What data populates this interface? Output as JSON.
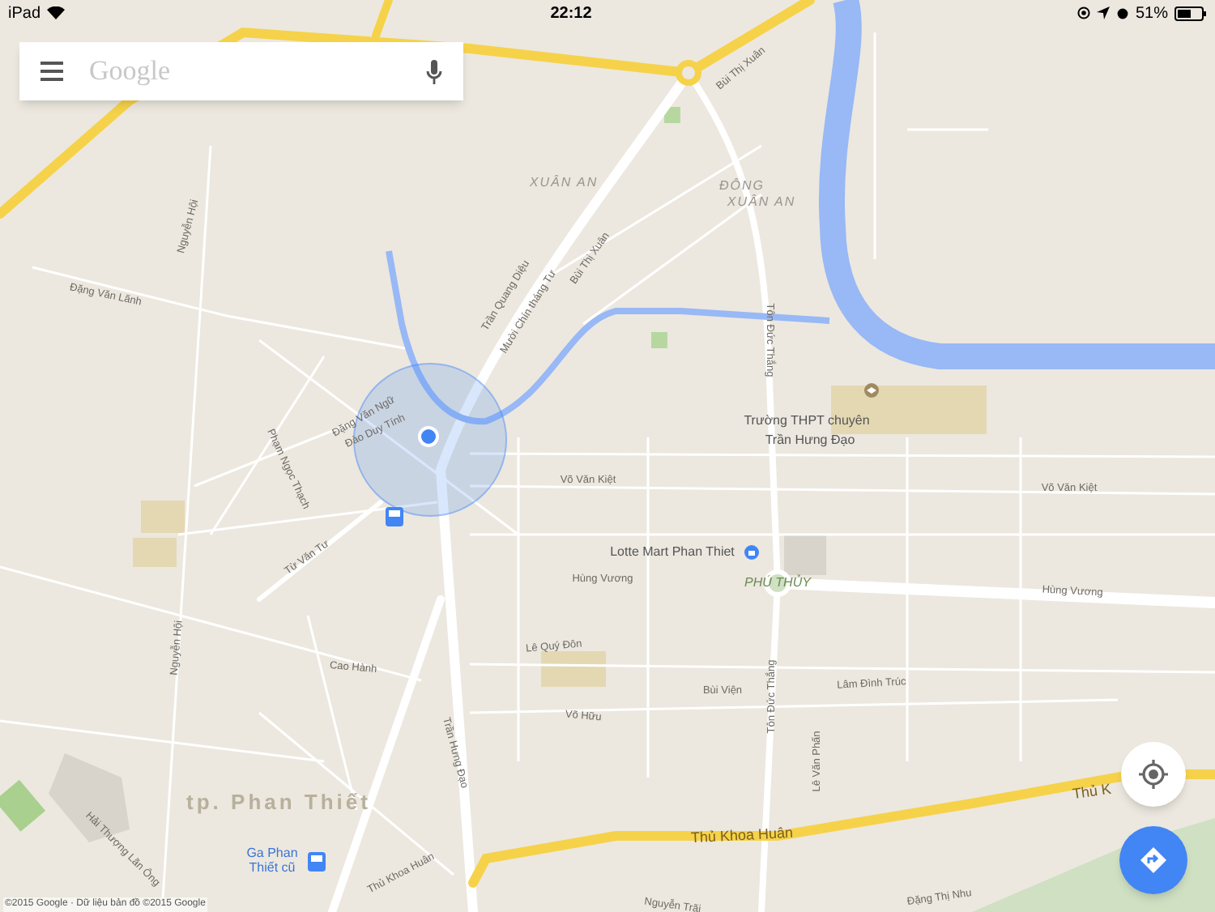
{
  "status_bar": {
    "device": "iPad",
    "time": "22:12",
    "battery": "51%"
  },
  "search": {
    "placeholder": "Google"
  },
  "map": {
    "labels": [
      {
        "text": "XUÂN AN",
        "kind": "area"
      },
      {
        "text": "ĐÔNG",
        "kind": "area"
      },
      {
        "text": "XUÂN AN",
        "kind": "area"
      },
      {
        "text": "Mười Chín tháng Tư",
        "kind": "street"
      },
      {
        "text": "Trần Quang Diệu",
        "kind": "street"
      },
      {
        "text": "Bùi Thị Xuân",
        "kind": "street"
      },
      {
        "text": "Bùi Thị Xuân",
        "kind": "street"
      },
      {
        "text": "Tôn Đức Thắng",
        "kind": "street"
      },
      {
        "text": "Tôn Đức Thắng",
        "kind": "street"
      },
      {
        "text": "Trường THPT chuyên",
        "kind": "poi"
      },
      {
        "text": "Trần Hưng Đạo",
        "kind": "poi"
      },
      {
        "text": "Võ Văn Kiệt",
        "kind": "street"
      },
      {
        "text": "Võ Văn Kiệt",
        "kind": "street"
      },
      {
        "text": "Lotte Mart Phan Thiet",
        "kind": "poi"
      },
      {
        "text": "PHÚ THỦY",
        "kind": "place"
      },
      {
        "text": "Hùng Vương",
        "kind": "street"
      },
      {
        "text": "Hùng Vương",
        "kind": "street"
      },
      {
        "text": "Lê Quý Đôn",
        "kind": "street"
      },
      {
        "text": "Cao Hành",
        "kind": "street"
      },
      {
        "text": "Võ Hữu",
        "kind": "street"
      },
      {
        "text": "Bùi Viện",
        "kind": "street"
      },
      {
        "text": "Lâm Đình Trúc",
        "kind": "street"
      },
      {
        "text": "Lê Văn Phấn",
        "kind": "street"
      },
      {
        "text": "Trần Hưng Đạo",
        "kind": "street"
      },
      {
        "text": "tp. Phan Thiết",
        "kind": "city"
      },
      {
        "text": "Thủ Khoa Huân",
        "kind": "major"
      },
      {
        "text": "Thủ K",
        "kind": "major"
      },
      {
        "text": "Thủ Khoa Huân",
        "kind": "street"
      },
      {
        "text": "Ga Phan Thiết cũ",
        "kind": "transit"
      },
      {
        "text": "Từ Văn Tư",
        "kind": "street"
      },
      {
        "text": "Nguyễn Hội",
        "kind": "street"
      },
      {
        "text": "Nguyễn Hội",
        "kind": "street"
      },
      {
        "text": "Đặng Văn Lãnh",
        "kind": "street"
      },
      {
        "text": "Phạm Ngọc Thạch",
        "kind": "street"
      },
      {
        "text": "Đặng Văn Ngữ",
        "kind": "street"
      },
      {
        "text": "Đào Duy Tính",
        "kind": "street"
      },
      {
        "text": "Hải Thượng Lãn Ông",
        "kind": "street"
      },
      {
        "text": "Nguyễn Trãi",
        "kind": "street"
      },
      {
        "text": "Đặng Thị Nhu",
        "kind": "street"
      }
    ],
    "copyright": "©2015 Google · Dữ liệu bản đồ ©2015 Google"
  }
}
